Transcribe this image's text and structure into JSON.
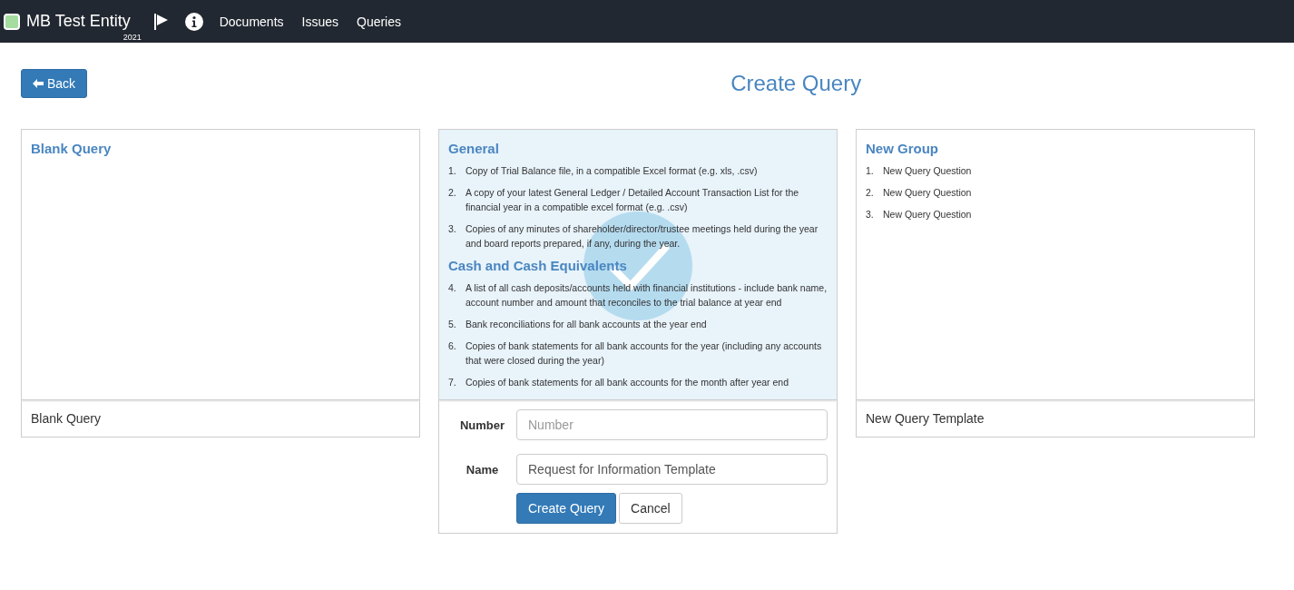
{
  "navbar": {
    "brand": "MB Test Entity",
    "year": "2021",
    "links": [
      "Documents",
      "Issues",
      "Queries"
    ]
  },
  "back_button": "Back",
  "title": "Create Query",
  "templates": [
    {
      "selected": false,
      "footer": "Blank Query",
      "sections": [
        {
          "title": "Blank Query"
        }
      ]
    },
    {
      "selected": true,
      "sections": [
        {
          "title": "General",
          "items": [
            {
              "number": "1.",
              "text": "Copy of Trial Balance file, in a compatible Excel format (e.g. xls, .csv)"
            },
            {
              "number": "2.",
              "text": "A copy of your latest General Ledger / Detailed Account Transaction List for the financial year in a compatible excel format (e.g. .csv)"
            },
            {
              "number": "3.",
              "text": "Copies of any minutes of shareholder/director/trustee meetings held during the year and board reports prepared, if any, during the year."
            }
          ]
        },
        {
          "title": "Cash and Cash Equivalents",
          "items": [
            {
              "number": "4.",
              "text": "A list of all cash deposits/accounts held with financial institutions - include bank name, account number and amount that reconciles to the trial balance at year end"
            },
            {
              "number": "5.",
              "text": "Bank reconciliations for all bank accounts at the year end"
            },
            {
              "number": "6.",
              "text": "Copies of bank statements for all bank accounts for the year (including any accounts that were closed during the year)"
            },
            {
              "number": "7.",
              "text": "Copies of bank statements for all bank accounts for the month after year end"
            }
          ]
        }
      ]
    },
    {
      "selected": false,
      "footer": "New Query Template",
      "sections": [
        {
          "title": "New Group",
          "items": [
            {
              "number": "1.",
              "text": "New Query Question"
            },
            {
              "number": "2.",
              "text": "New Query Question"
            },
            {
              "number": "3.",
              "text": "New Query Question"
            }
          ]
        }
      ]
    }
  ],
  "form": {
    "number_label": "Number",
    "number_placeholder": "Number",
    "name_label": "Name",
    "name_value": "Request for Information Template",
    "submit": "Create Query",
    "cancel": "Cancel"
  }
}
